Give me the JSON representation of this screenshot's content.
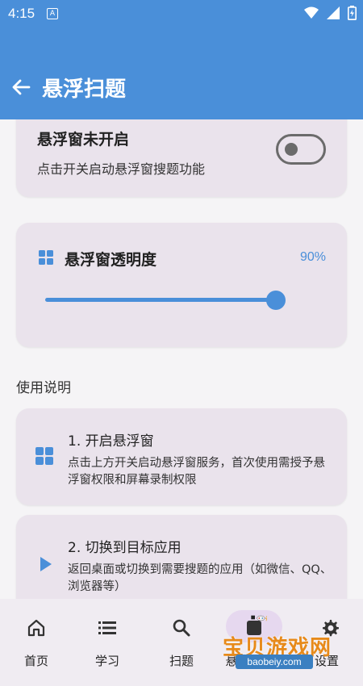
{
  "status": {
    "time": "4:15",
    "notif_letter": "A"
  },
  "app_bar": {
    "title": "悬浮扫题"
  },
  "floating_card": {
    "title": "悬浮窗未开启",
    "subtitle": "点击开关启动悬浮窗搜题功能",
    "toggle_on": false
  },
  "opacity_card": {
    "title": "悬浮窗透明度",
    "value_text": "90%",
    "value": 0.9,
    "icon": "grid-icon"
  },
  "instructions": {
    "title": "使用说明",
    "steps": [
      {
        "title": "1. 开启悬浮窗",
        "desc": "点击上方开关启动悬浮窗服务，首次使用需授予悬浮窗权限和屏幕录制权限",
        "icon": "grid-icon"
      },
      {
        "title": "2. 切换到目标应用",
        "desc": "返回桌面或切换到需要搜题的应用（如微信、QQ、浏览器等）",
        "icon": "play-icon"
      }
    ]
  },
  "bottom_nav": {
    "items": [
      {
        "label": "首页",
        "icon": "home-icon"
      },
      {
        "label": "学习",
        "icon": "list-icon"
      },
      {
        "label": "扫题",
        "icon": "search-icon"
      },
      {
        "label": "悬",
        "icon": "float-icon"
      },
      {
        "label": "设置",
        "icon": "gear-icon"
      }
    ]
  },
  "watermark": {
    "text": "宝贝游戏网",
    "url": "baobeiy.com"
  },
  "colors": {
    "primary": "#4a8fd9",
    "card": "#eae3ec",
    "background": "#f5f4f6"
  }
}
